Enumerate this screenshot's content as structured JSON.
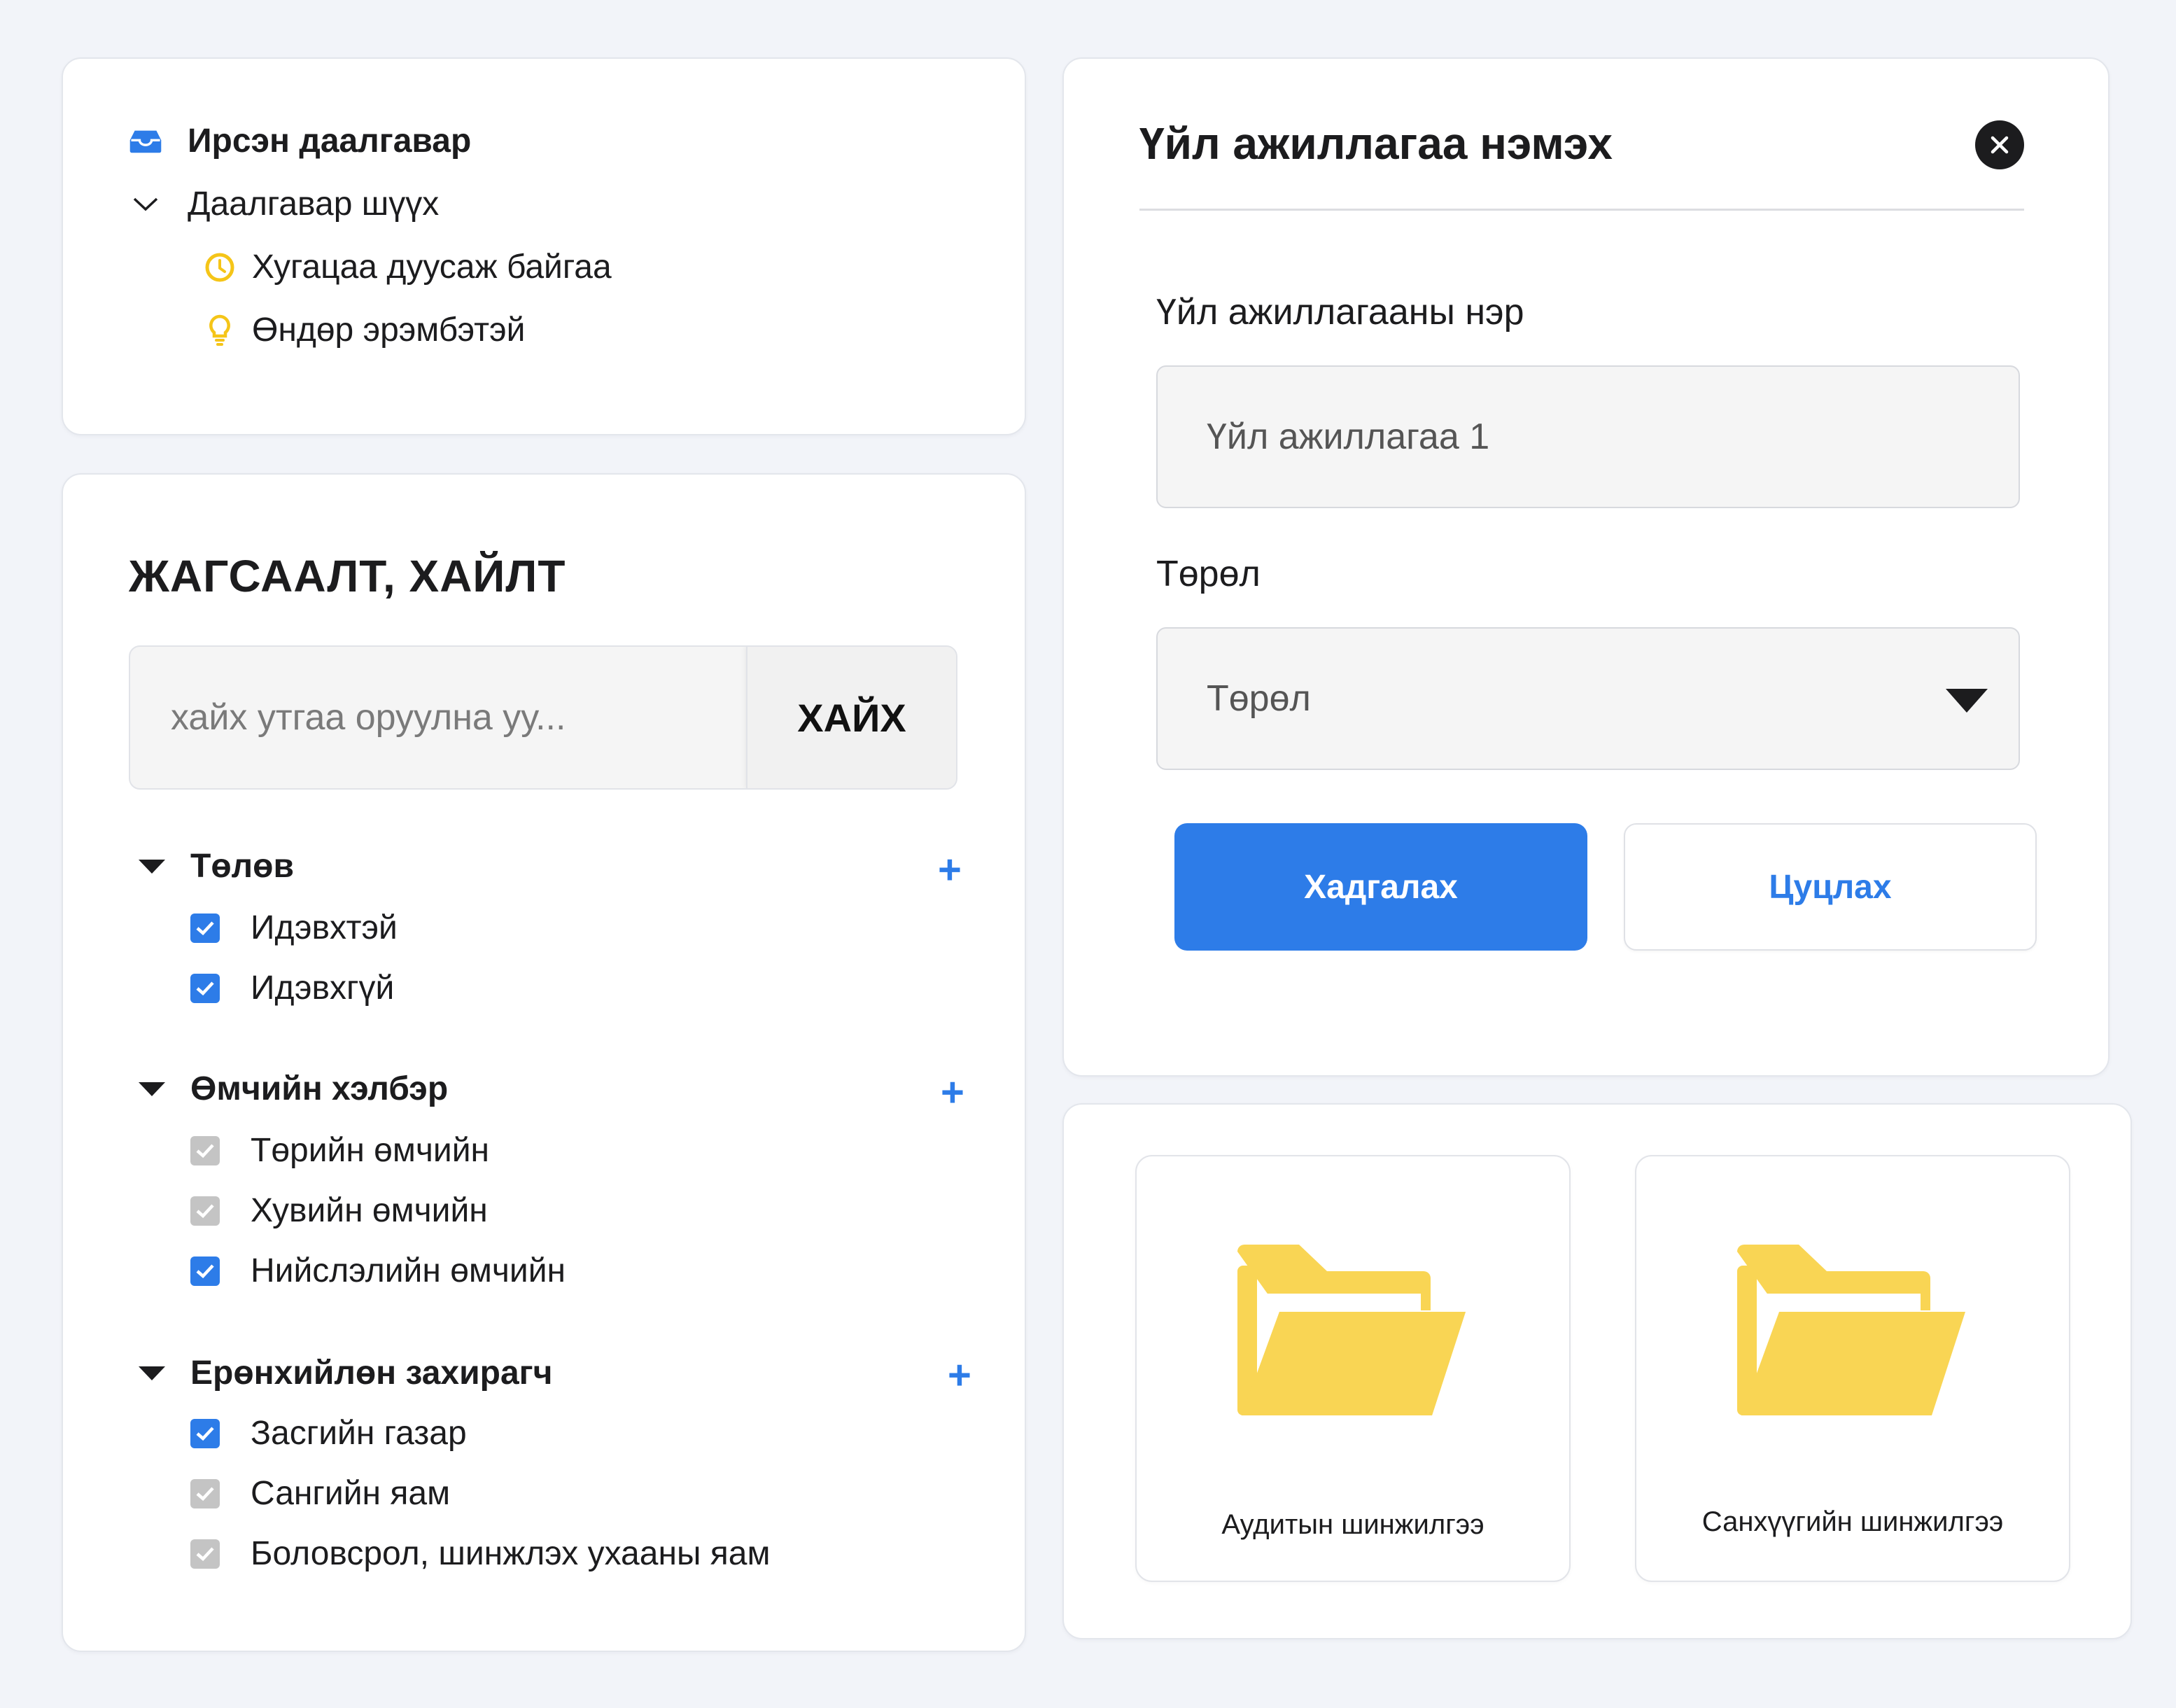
{
  "colors": {
    "accent": "#2d7ce8",
    "folder": "#f9d554",
    "warning": "#f5c518",
    "background": "#f2f4f9"
  },
  "tasks": {
    "inbox": {
      "label": "Ирсэн даалгавар",
      "icon": "inbox-icon"
    },
    "filter": {
      "label": "Даалгавар шүүх",
      "icon": "chevron-down-icon"
    },
    "items": [
      {
        "label": "Хугацаа дуусаж байгаа",
        "icon": "clock-icon"
      },
      {
        "label": "Өндөр эрэмбэтэй",
        "icon": "lightbulb-icon"
      }
    ]
  },
  "list": {
    "title": "ЖАГСААЛТ, ХАЙЛТ",
    "search": {
      "placeholder": "хайх утгаа оруулна уу...",
      "button": "ХАЙХ"
    },
    "groups": [
      {
        "title": "Төлөв",
        "items": [
          {
            "label": "Идэвхтэй",
            "checked": true
          },
          {
            "label": "Идэвхгүй",
            "checked": true
          }
        ]
      },
      {
        "title": "Өмчийн хэлбэр",
        "items": [
          {
            "label": "Төрийн өмчийн",
            "checked": false
          },
          {
            "label": "Хувийн өмчийн",
            "checked": false
          },
          {
            "label": "Нийслэлийн өмчийн",
            "checked": true
          }
        ]
      },
      {
        "title": "Ерөнхийлөн захирагч",
        "items": [
          {
            "label": "Засгийн газар",
            "checked": true
          },
          {
            "label": "Сангийн яам",
            "checked": false
          },
          {
            "label": "Боловсрол, шинжлэх ухааны яам",
            "checked": false
          }
        ]
      }
    ]
  },
  "dialog": {
    "title": "Үйл ажиллагаа нэмэх",
    "name_label": "Үйл ажиллагааны нэр",
    "name_value": "Үйл ажиллагаа 1",
    "type_label": "Төрөл",
    "type_value": "Төрөл",
    "save": "Хадгалах",
    "cancel": "Цуцлах"
  },
  "folders": [
    {
      "label": "Аудитын шинжилгээ",
      "icon": "folder-icon"
    },
    {
      "label": "Санхүүгийн шинжилгээ",
      "icon": "folder-icon"
    }
  ]
}
